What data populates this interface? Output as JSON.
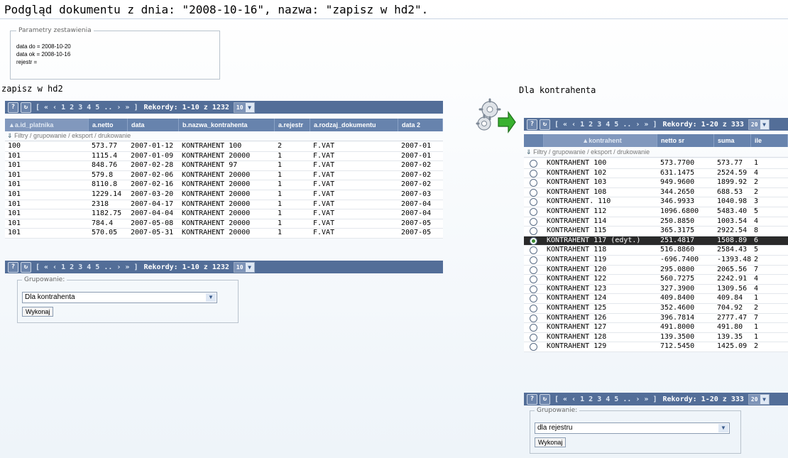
{
  "page_title": "Podgląd dokumentu z dnia: \"2008-10-16\", nazwa: \"zapisz w hd2\".",
  "params": {
    "legend": "Parametry zestawienia",
    "lines": [
      "data do = 2008-10-20",
      "data ok = 2008-10-16",
      "rejestr ="
    ]
  },
  "left": {
    "title": "zapisz w hd2",
    "pagination": {
      "help": "?",
      "refresh": "↻",
      "pages": "[ « ‹ 1 2 3 4 5 .. › » ]",
      "records": "Rekordy: 1-10 z 1232",
      "per_page": "10"
    },
    "columns": [
      "▲a.id_platnika",
      "a.netto",
      "data",
      "b.nazwa_kontrahenta",
      "a.rejestr",
      "a.rodzaj_dokumentu",
      "data 2"
    ],
    "filters": "Filtry / grupowanie / eksport / drukowanie",
    "rows": [
      [
        "100",
        "573.77",
        "2007-01-12",
        "KONTRAHENT 100",
        "2",
        "F.VAT",
        "2007-01"
      ],
      [
        "101",
        "1115.4",
        "2007-01-09",
        "KONTRAHENT 20000",
        "1",
        "F.VAT",
        "2007-01"
      ],
      [
        "101",
        "848.76",
        "2007-02-28",
        "KONTRAHENT 97",
        "1",
        "F.VAT",
        "2007-02"
      ],
      [
        "101",
        "579.8",
        "2007-02-06",
        "KONTRAHENT 20000",
        "1",
        "F.VAT",
        "2007-02"
      ],
      [
        "101",
        "8110.8",
        "2007-02-16",
        "KONTRAHENT 20000",
        "1",
        "F.VAT",
        "2007-02"
      ],
      [
        "101",
        "1229.14",
        "2007-03-20",
        "KONTRAHENT 20000",
        "1",
        "F.VAT",
        "2007-03"
      ],
      [
        "101",
        "2318",
        "2007-04-17",
        "KONTRAHENT 20000",
        "1",
        "F.VAT",
        "2007-04"
      ],
      [
        "101",
        "1182.75",
        "2007-04-04",
        "KONTRAHENT 20000",
        "1",
        "F.VAT",
        "2007-04"
      ],
      [
        "101",
        "784.4",
        "2007-05-08",
        "KONTRAHENT 20000",
        "1",
        "F.VAT",
        "2007-05"
      ],
      [
        "101",
        "570.05",
        "2007-05-31",
        "KONTRAHENT 20000",
        "1",
        "F.VAT",
        "2007-05"
      ]
    ],
    "group": {
      "legend": "Grupowanie:",
      "value": "Dla kontrahenta",
      "button": "Wykonaj"
    }
  },
  "right": {
    "title": "Dla kontrahenta",
    "pagination": {
      "help": "?",
      "refresh": "↻",
      "pages": "[ « ‹ 1 2 3 4 5 .. › » ]",
      "records": "Rekordy: 1-20 z 333",
      "per_page": "20"
    },
    "columns": [
      "",
      "▲kontrahent",
      "netto sr",
      "suma",
      "ile"
    ],
    "filters": "Filtry / grupowanie / eksport / drukowanie",
    "selected_index": 8,
    "rows": [
      [
        "KONTRAHENT 100",
        "573.7700",
        "573.77",
        "1"
      ],
      [
        "KONTRAHENT 102",
        "631.1475",
        "2524.59",
        "4"
      ],
      [
        "KONTRAHENT 103",
        "949.9600",
        "1899.92",
        "2"
      ],
      [
        "KONTRAHENT 108",
        "344.2650",
        "688.53",
        "2"
      ],
      [
        "KONTRAHENT. 110",
        "346.9933",
        "1040.98",
        "3"
      ],
      [
        "KONTRAHENT 112",
        "1096.6800",
        "5483.40",
        "5"
      ],
      [
        "KONTRAHENT 114",
        "250.8850",
        "1003.54",
        "4"
      ],
      [
        "KONTRAHENT 115",
        "365.3175",
        "2922.54",
        "8"
      ],
      [
        "KONTRAHENT 117 (edyt.)",
        "251.4817",
        "1508.89",
        "6"
      ],
      [
        "KONTRAHENT 118",
        "516.8860",
        "2584.43",
        "5"
      ],
      [
        "KONTRAHENT 119",
        "-696.7400",
        "-1393.48",
        "2"
      ],
      [
        "KONTRAHENT 120",
        "295.0800",
        "2065.56",
        "7"
      ],
      [
        "KONTRAHENT 122",
        "560.7275",
        "2242.91",
        "4"
      ],
      [
        "KONTRAHENT 123",
        "327.3900",
        "1309.56",
        "4"
      ],
      [
        "KONTRAHENT 124",
        "409.8400",
        "409.84",
        "1"
      ],
      [
        "KONTRAHENT 125",
        "352.4600",
        "704.92",
        "2"
      ],
      [
        "KONTRAHENT 126",
        "396.7814",
        "2777.47",
        "7"
      ],
      [
        "KONTRAHENT 127",
        "491.8000",
        "491.80",
        "1"
      ],
      [
        "KONTRAHENT 128",
        "139.3500",
        "139.35",
        "1"
      ],
      [
        "KONTRAHENT 129",
        "712.5450",
        "1425.09",
        "2"
      ]
    ],
    "group": {
      "legend": "Grupowanie:",
      "value": "dla rejestru",
      "button": "Wykonaj"
    }
  },
  "icons": {
    "gears": "gears-arrow-icon"
  }
}
